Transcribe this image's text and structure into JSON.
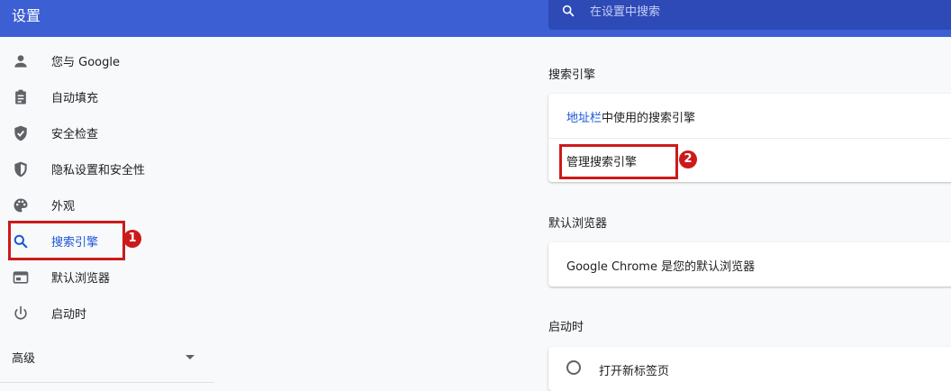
{
  "header": {
    "title": "设置",
    "search_placeholder": "在设置中搜索"
  },
  "sidebar": {
    "items": [
      {
        "label": "您与 Google",
        "icon": "person-icon"
      },
      {
        "label": "自动填充",
        "icon": "clipboard-icon"
      },
      {
        "label": "安全检查",
        "icon": "shield-check-icon"
      },
      {
        "label": "隐私设置和安全性",
        "icon": "shield-half-icon"
      },
      {
        "label": "外观",
        "icon": "palette-icon"
      },
      {
        "label": "搜索引擎",
        "icon": "search-icon",
        "active": true
      },
      {
        "label": "默认浏览器",
        "icon": "browser-window-icon"
      },
      {
        "label": "启动时",
        "icon": "power-icon"
      }
    ],
    "advanced_label": "高级"
  },
  "annotations": {
    "badge_1": "1",
    "badge_2": "2"
  },
  "main": {
    "search_engine": {
      "title": "搜索引擎",
      "address_bar_link": "地址栏",
      "address_bar_suffix": "中使用的搜索引擎",
      "manage_label": "管理搜索引擎"
    },
    "default_browser": {
      "title": "默认浏览器",
      "status": "Google Chrome 是您的默认浏览器"
    },
    "on_startup": {
      "title": "启动时",
      "option_new_tab": "打开新标签页"
    }
  },
  "colors": {
    "header": "#3c5fd4",
    "search_bar": "#2d4ab6",
    "accent": "#1a56d8",
    "highlight": "#cc1a1a"
  }
}
